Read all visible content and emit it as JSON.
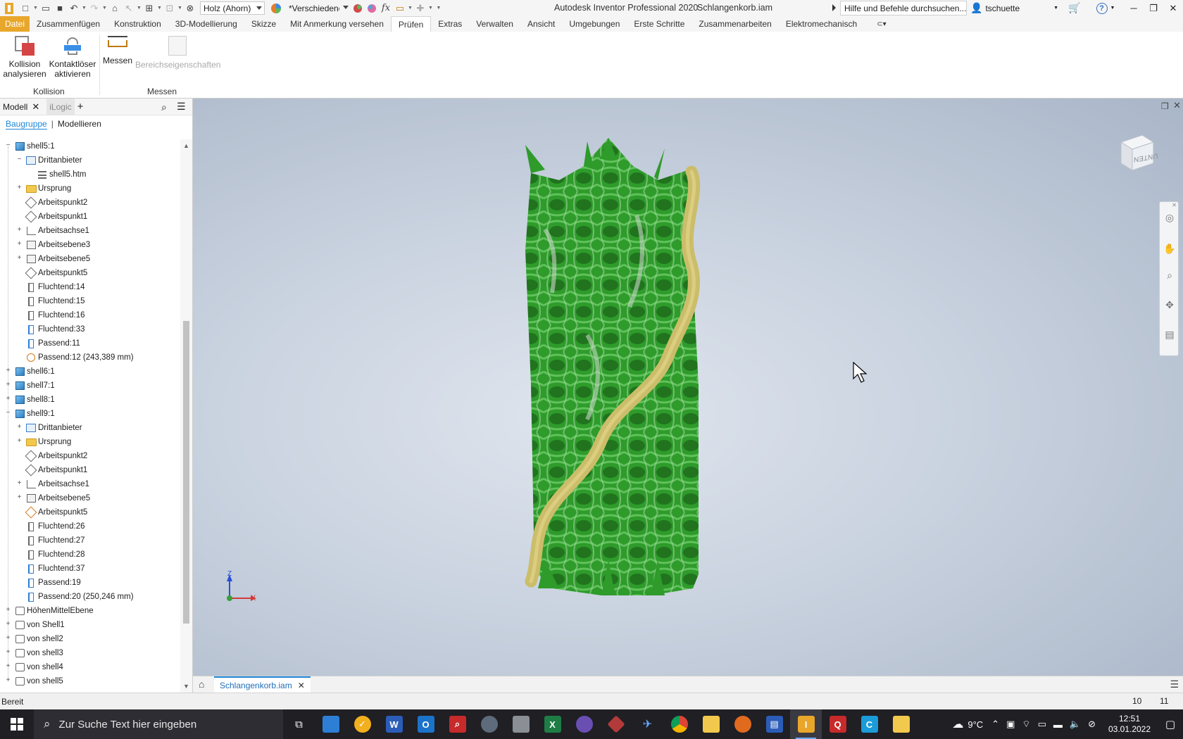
{
  "titlebar": {
    "material": "Holz (Ahorn)",
    "appearance": "*Verschiedene",
    "app_title": "Autodesk Inventor Professional 2020",
    "doc_title": "Schlangenkorb.iam",
    "help_search": "Hilfe und Befehle durchsuchen...",
    "user": "tschuette"
  },
  "ribbon_tabs": [
    {
      "label": "Datei"
    },
    {
      "label": "Zusammenfügen"
    },
    {
      "label": "Konstruktion"
    },
    {
      "label": "3D-Modellierung"
    },
    {
      "label": "Skizze"
    },
    {
      "label": "Mit Anmerkung versehen"
    },
    {
      "label": "Prüfen"
    },
    {
      "label": "Extras"
    },
    {
      "label": "Verwalten"
    },
    {
      "label": "Ansicht"
    },
    {
      "label": "Umgebungen"
    },
    {
      "label": "Erste Schritte"
    },
    {
      "label": "Zusammenarbeiten"
    },
    {
      "label": "Elektromechanisch"
    }
  ],
  "ribbon": {
    "collision_line1": "Kollision",
    "collision_line2": "analysieren",
    "contact_line1": "Kontaktlöser",
    "contact_line2": "aktivieren",
    "group_collision": "Kollision",
    "measure": "Messen",
    "region_props": "Bereichseigenschaften",
    "group_measure": "Messen"
  },
  "browser": {
    "tab_model": "Modell",
    "tab_logic": "iLogic",
    "sub_assembly": "Baugruppe",
    "sub_modeling": "Modellieren",
    "nodes": [
      {
        "label": "shell5:1",
        "icon": "cube",
        "level": 0,
        "exp": "−"
      },
      {
        "label": "Drittanbieter",
        "icon": "third",
        "level": 1,
        "exp": "−"
      },
      {
        "label": "shell5.htm",
        "icon": "list",
        "level": 2,
        "exp": ""
      },
      {
        "label": "Ursprung",
        "icon": "folder",
        "level": 1,
        "exp": "+"
      },
      {
        "label": "Arbeitspunkt2",
        "icon": "point",
        "level": 1,
        "exp": ""
      },
      {
        "label": "Arbeitspunkt1",
        "icon": "point",
        "level": 1,
        "exp": ""
      },
      {
        "label": "Arbeitsachse1",
        "icon": "axis",
        "level": 1,
        "exp": "+"
      },
      {
        "label": "Arbeitsebene3",
        "icon": "plane",
        "level": 1,
        "exp": "+"
      },
      {
        "label": "Arbeitsebene5",
        "icon": "plane",
        "level": 1,
        "exp": "+"
      },
      {
        "label": "Arbeitspunkt5",
        "icon": "point",
        "level": 1,
        "exp": ""
      },
      {
        "label": "Fluchtend:14",
        "icon": "constraint",
        "level": 1,
        "exp": ""
      },
      {
        "label": "Fluchtend:15",
        "icon": "constraint",
        "level": 1,
        "exp": ""
      },
      {
        "label": "Fluchtend:16",
        "icon": "constraint",
        "level": 1,
        "exp": ""
      },
      {
        "label": "Fluchtend:33",
        "icon": "constraint-blue",
        "level": 1,
        "exp": ""
      },
      {
        "label": "Passend:11",
        "icon": "constraint-blue",
        "level": 1,
        "exp": ""
      },
      {
        "label": "Passend:12 (243,389 mm)",
        "icon": "insert",
        "level": 1,
        "exp": ""
      },
      {
        "label": "shell6:1",
        "icon": "cube",
        "level": 0,
        "exp": "+"
      },
      {
        "label": "shell7:1",
        "icon": "cube",
        "level": 0,
        "exp": "+"
      },
      {
        "label": "shell8:1",
        "icon": "cube",
        "level": 0,
        "exp": "+"
      },
      {
        "label": "shell9:1",
        "icon": "cube",
        "level": 0,
        "exp": "−"
      },
      {
        "label": "Drittanbieter",
        "icon": "third",
        "level": 1,
        "exp": "+"
      },
      {
        "label": "Ursprung",
        "icon": "folder",
        "level": 1,
        "exp": "+"
      },
      {
        "label": "Arbeitspunkt2",
        "icon": "point",
        "level": 1,
        "exp": ""
      },
      {
        "label": "Arbeitspunkt1",
        "icon": "point",
        "level": 1,
        "exp": ""
      },
      {
        "label": "Arbeitsachse1",
        "icon": "axis",
        "level": 1,
        "exp": "+"
      },
      {
        "label": "Arbeitsebene5",
        "icon": "plane",
        "level": 1,
        "exp": "+"
      },
      {
        "label": "Arbeitspunkt5",
        "icon": "point-orange",
        "level": 1,
        "exp": ""
      },
      {
        "label": "Fluchtend:26",
        "icon": "constraint",
        "level": 1,
        "exp": ""
      },
      {
        "label": "Fluchtend:27",
        "icon": "constraint",
        "level": 1,
        "exp": ""
      },
      {
        "label": "Fluchtend:28",
        "icon": "constraint",
        "level": 1,
        "exp": ""
      },
      {
        "label": "Fluchtend:37",
        "icon": "constraint-blue",
        "level": 1,
        "exp": ""
      },
      {
        "label": "Passend:19",
        "icon": "constraint-blue",
        "level": 1,
        "exp": ""
      },
      {
        "label": "Passend:20 (250,246 mm)",
        "icon": "constraint-blue",
        "level": 1,
        "exp": ""
      },
      {
        "label": "HöhenMittelEbene",
        "icon": "sketch",
        "level": 0,
        "exp": "+"
      },
      {
        "label": "von Shell1",
        "icon": "sketch",
        "level": 0,
        "exp": "+"
      },
      {
        "label": "von shell2",
        "icon": "sketch",
        "level": 0,
        "exp": "+"
      },
      {
        "label": "von shell3",
        "icon": "sketch",
        "level": 0,
        "exp": "+"
      },
      {
        "label": "von shell4",
        "icon": "sketch",
        "level": 0,
        "exp": "+"
      },
      {
        "label": "von shell5",
        "icon": "sketch",
        "level": 0,
        "exp": "+"
      }
    ]
  },
  "viewport": {
    "viewcube_label": "UNTEN",
    "axis_x": "X",
    "axis_z": "Z"
  },
  "doc_tab": "Schlangenkorb.iam",
  "status": {
    "text": "Bereit",
    "num1": "10",
    "num2": "11"
  },
  "taskbar": {
    "search_placeholder": "Zur Suche Text hier eingeben",
    "weather": "9°C",
    "time": "12:51",
    "date": "03.01.2022"
  },
  "colors": {
    "file_tab": "#e8a72b",
    "model_green": "#2f9a2a",
    "model_yellow": "#cbbd6a",
    "accent": "#1f88d8"
  }
}
